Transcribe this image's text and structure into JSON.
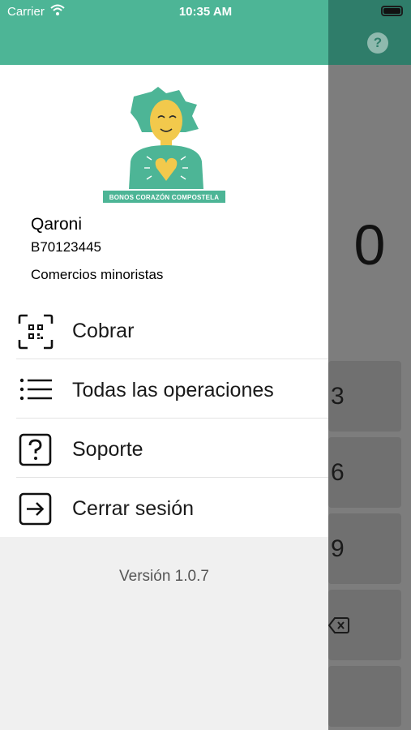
{
  "status_bar": {
    "carrier": "Carrier",
    "time": "10:35 AM"
  },
  "background_app": {
    "amount": "0",
    "keys": [
      "3",
      "6",
      "9"
    ]
  },
  "drawer": {
    "logo_text": "BONOS CORAZÓN COMPOSTELA",
    "company_name": "Qaroni",
    "tax_id": "B70123445",
    "category": "Comercios minoristas",
    "menu": [
      {
        "label": "Cobrar",
        "icon": "qr-code-icon"
      },
      {
        "label": "Todas las operaciones",
        "icon": "list-icon"
      },
      {
        "label": "Soporte",
        "icon": "question-square-icon"
      },
      {
        "label": "Cerrar sesión",
        "icon": "logout-icon"
      }
    ],
    "version": "Versión 1.0.7"
  },
  "colors": {
    "accent": "#4db596",
    "dimmed_header": "#2f7d6a",
    "heart": "#f2c94c"
  }
}
